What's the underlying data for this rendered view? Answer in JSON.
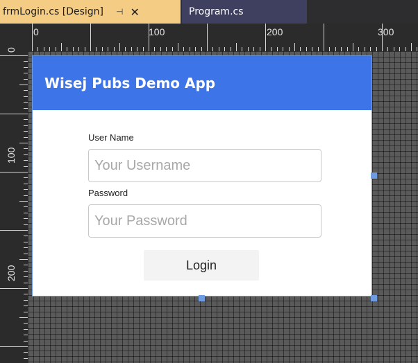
{
  "tabs": [
    {
      "label": "frmLogin.cs [Design]",
      "pin_icon": "pin-icon",
      "close_icon": "close-icon",
      "active": true
    },
    {
      "label": "Program.cs",
      "active": false
    }
  ],
  "ruler": {
    "top_labels": [
      "0",
      "100",
      "200",
      "300"
    ],
    "left_labels": [
      "0",
      "100",
      "200"
    ]
  },
  "form": {
    "title": "Wisej Pubs Demo App",
    "username": {
      "label": "User Name",
      "placeholder": "Your Username",
      "value": ""
    },
    "password": {
      "label": "Password",
      "placeholder": "Your Password",
      "value": ""
    },
    "login_label": "Login"
  },
  "colors": {
    "accent": "#3d74e8",
    "active_tab": "#f5cc84",
    "inactive_tab": "#3f3f60",
    "selection_handle": "#6f9be0"
  }
}
